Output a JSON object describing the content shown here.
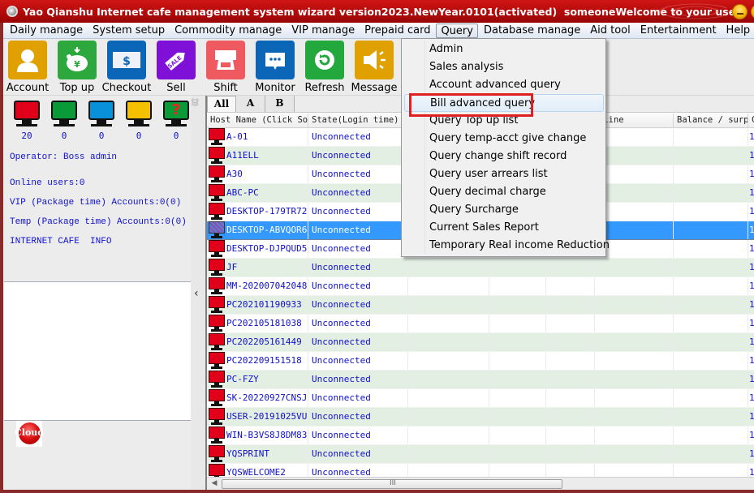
{
  "window": {
    "title": "Yao Qianshu Internet cafe management system wizard version2023.NewYear.0101(activated)  someoneWelcome to your use"
  },
  "menubar": [
    {
      "label": "Daily manage"
    },
    {
      "label": "System setup"
    },
    {
      "label": "Commodity manage"
    },
    {
      "label": "VIP manage"
    },
    {
      "label": "Prepaid card"
    },
    {
      "label": "Query",
      "active": true
    },
    {
      "label": "Database manage"
    },
    {
      "label": "Aid tool"
    },
    {
      "label": "Entertainment"
    },
    {
      "label": "Help"
    }
  ],
  "toolbar": [
    {
      "label": "Account",
      "icon": "user-icon",
      "color": "#e0a000"
    },
    {
      "label": "Top up",
      "icon": "piggy-bank-icon",
      "color": "#2ca83c"
    },
    {
      "label": "Checkout",
      "icon": "dollar-bill-icon",
      "color": "#0c66b8"
    },
    {
      "label": "Sell",
      "icon": "sale-tag-icon",
      "color": "#7e10d8"
    },
    {
      "label": "Shift",
      "icon": "shift-icon",
      "color": "#ee5a5f"
    },
    {
      "label": "Monitor",
      "icon": "chat-bubble-icon",
      "color": "#0c66b8"
    },
    {
      "label": "Refresh",
      "icon": "refresh-icon",
      "color": "#22a83c"
    },
    {
      "label": "Message",
      "icon": "speaker-icon",
      "color": "#e0a000"
    }
  ],
  "status_monitors": [
    {
      "status": "unconnected",
      "color": "#e0001a",
      "count": "20"
    },
    {
      "status": "online",
      "color": "#0a9a38",
      "count": "0"
    },
    {
      "status": "vip",
      "color": "#0890d8",
      "count": "0"
    },
    {
      "status": "temp",
      "color": "#f4c000",
      "count": "0"
    },
    {
      "status": "unknown",
      "color": "#0a9a38",
      "count": "0",
      "glyph": "?"
    }
  ],
  "left_info": {
    "operator": "Operator: Boss admin",
    "online_users": "Online users:0",
    "vip_accounts": "VIP (Package time) Accounts:0(0)",
    "temp_accounts": "Temp (Package time) Accounts:0(0)",
    "cafe_info": "INTERNET CAFE  INFO",
    "cloud_badge": "Cloud"
  },
  "grid": {
    "tabs": [
      {
        "label": "All",
        "active": true
      },
      {
        "label": "A"
      },
      {
        "label": "B"
      }
    ],
    "columns": [
      "Host Name (Click So",
      "State(Login time)",
      "",
      "",
      "",
      "nline",
      "Balance / surpl",
      "C"
    ],
    "rows": [
      {
        "host": "A-01",
        "state": "Unconnected",
        "last": "1"
      },
      {
        "host": "A11ELL",
        "state": "Unconnected",
        "last": "1"
      },
      {
        "host": "A30",
        "state": "Unconnected",
        "last": "1"
      },
      {
        "host": "ABC-PC",
        "state": "Unconnected",
        "last": "1"
      },
      {
        "host": "DESKTOP-179TR72",
        "state": "Unconnected",
        "last": "1"
      },
      {
        "host": "DESKTOP-ABVQOR6",
        "state": "Unconnected",
        "last": "1",
        "selected": true
      },
      {
        "host": "DESKTOP-DJPQUD5",
        "state": "Unconnected",
        "last": "1"
      },
      {
        "host": "JF",
        "state": "Unconnected",
        "last": "1"
      },
      {
        "host": "MM-202007042048",
        "state": "Unconnected",
        "last": "1"
      },
      {
        "host": "PC202101190933",
        "state": "Unconnected",
        "last": "1"
      },
      {
        "host": "PC202105181038",
        "state": "Unconnected",
        "last": "1"
      },
      {
        "host": "PC202205161449",
        "state": "Unconnected",
        "last": "1"
      },
      {
        "host": "PC202209151518",
        "state": "Unconnected",
        "last": "1"
      },
      {
        "host": "PC-FZY",
        "state": "Unconnected",
        "last": "1"
      },
      {
        "host": "SK-20220927CNSJ",
        "state": "Unconnected",
        "last": "1"
      },
      {
        "host": "USER-20191025VU",
        "state": "Unconnected",
        "last": "1"
      },
      {
        "host": "WIN-B3VS8J8DM83",
        "state": "Unconnected",
        "last": "1"
      },
      {
        "host": "YQSPRINT",
        "state": "Unconnected",
        "last": "1"
      },
      {
        "host": "YQSWELCOME2",
        "state": "Unconnected",
        "last": "1"
      }
    ],
    "scroll_grip": "III"
  },
  "query_menu": {
    "items": [
      {
        "label": "Admin"
      },
      {
        "label": "Sales analysis"
      },
      {
        "label": "Account advanced query"
      },
      {
        "label": "Bill advanced query",
        "hover": true,
        "highlighted": true
      },
      {
        "label": "Query Top up list"
      },
      {
        "label": "Query temp-acct give change"
      },
      {
        "label": "Query change shift record"
      },
      {
        "label": "Query user arrears list"
      },
      {
        "label": "Query decimal charge"
      },
      {
        "label": "Query Surcharge"
      },
      {
        "label": "Current Sales Report"
      },
      {
        "label": "Temporary Real income Reduction"
      }
    ]
  }
}
